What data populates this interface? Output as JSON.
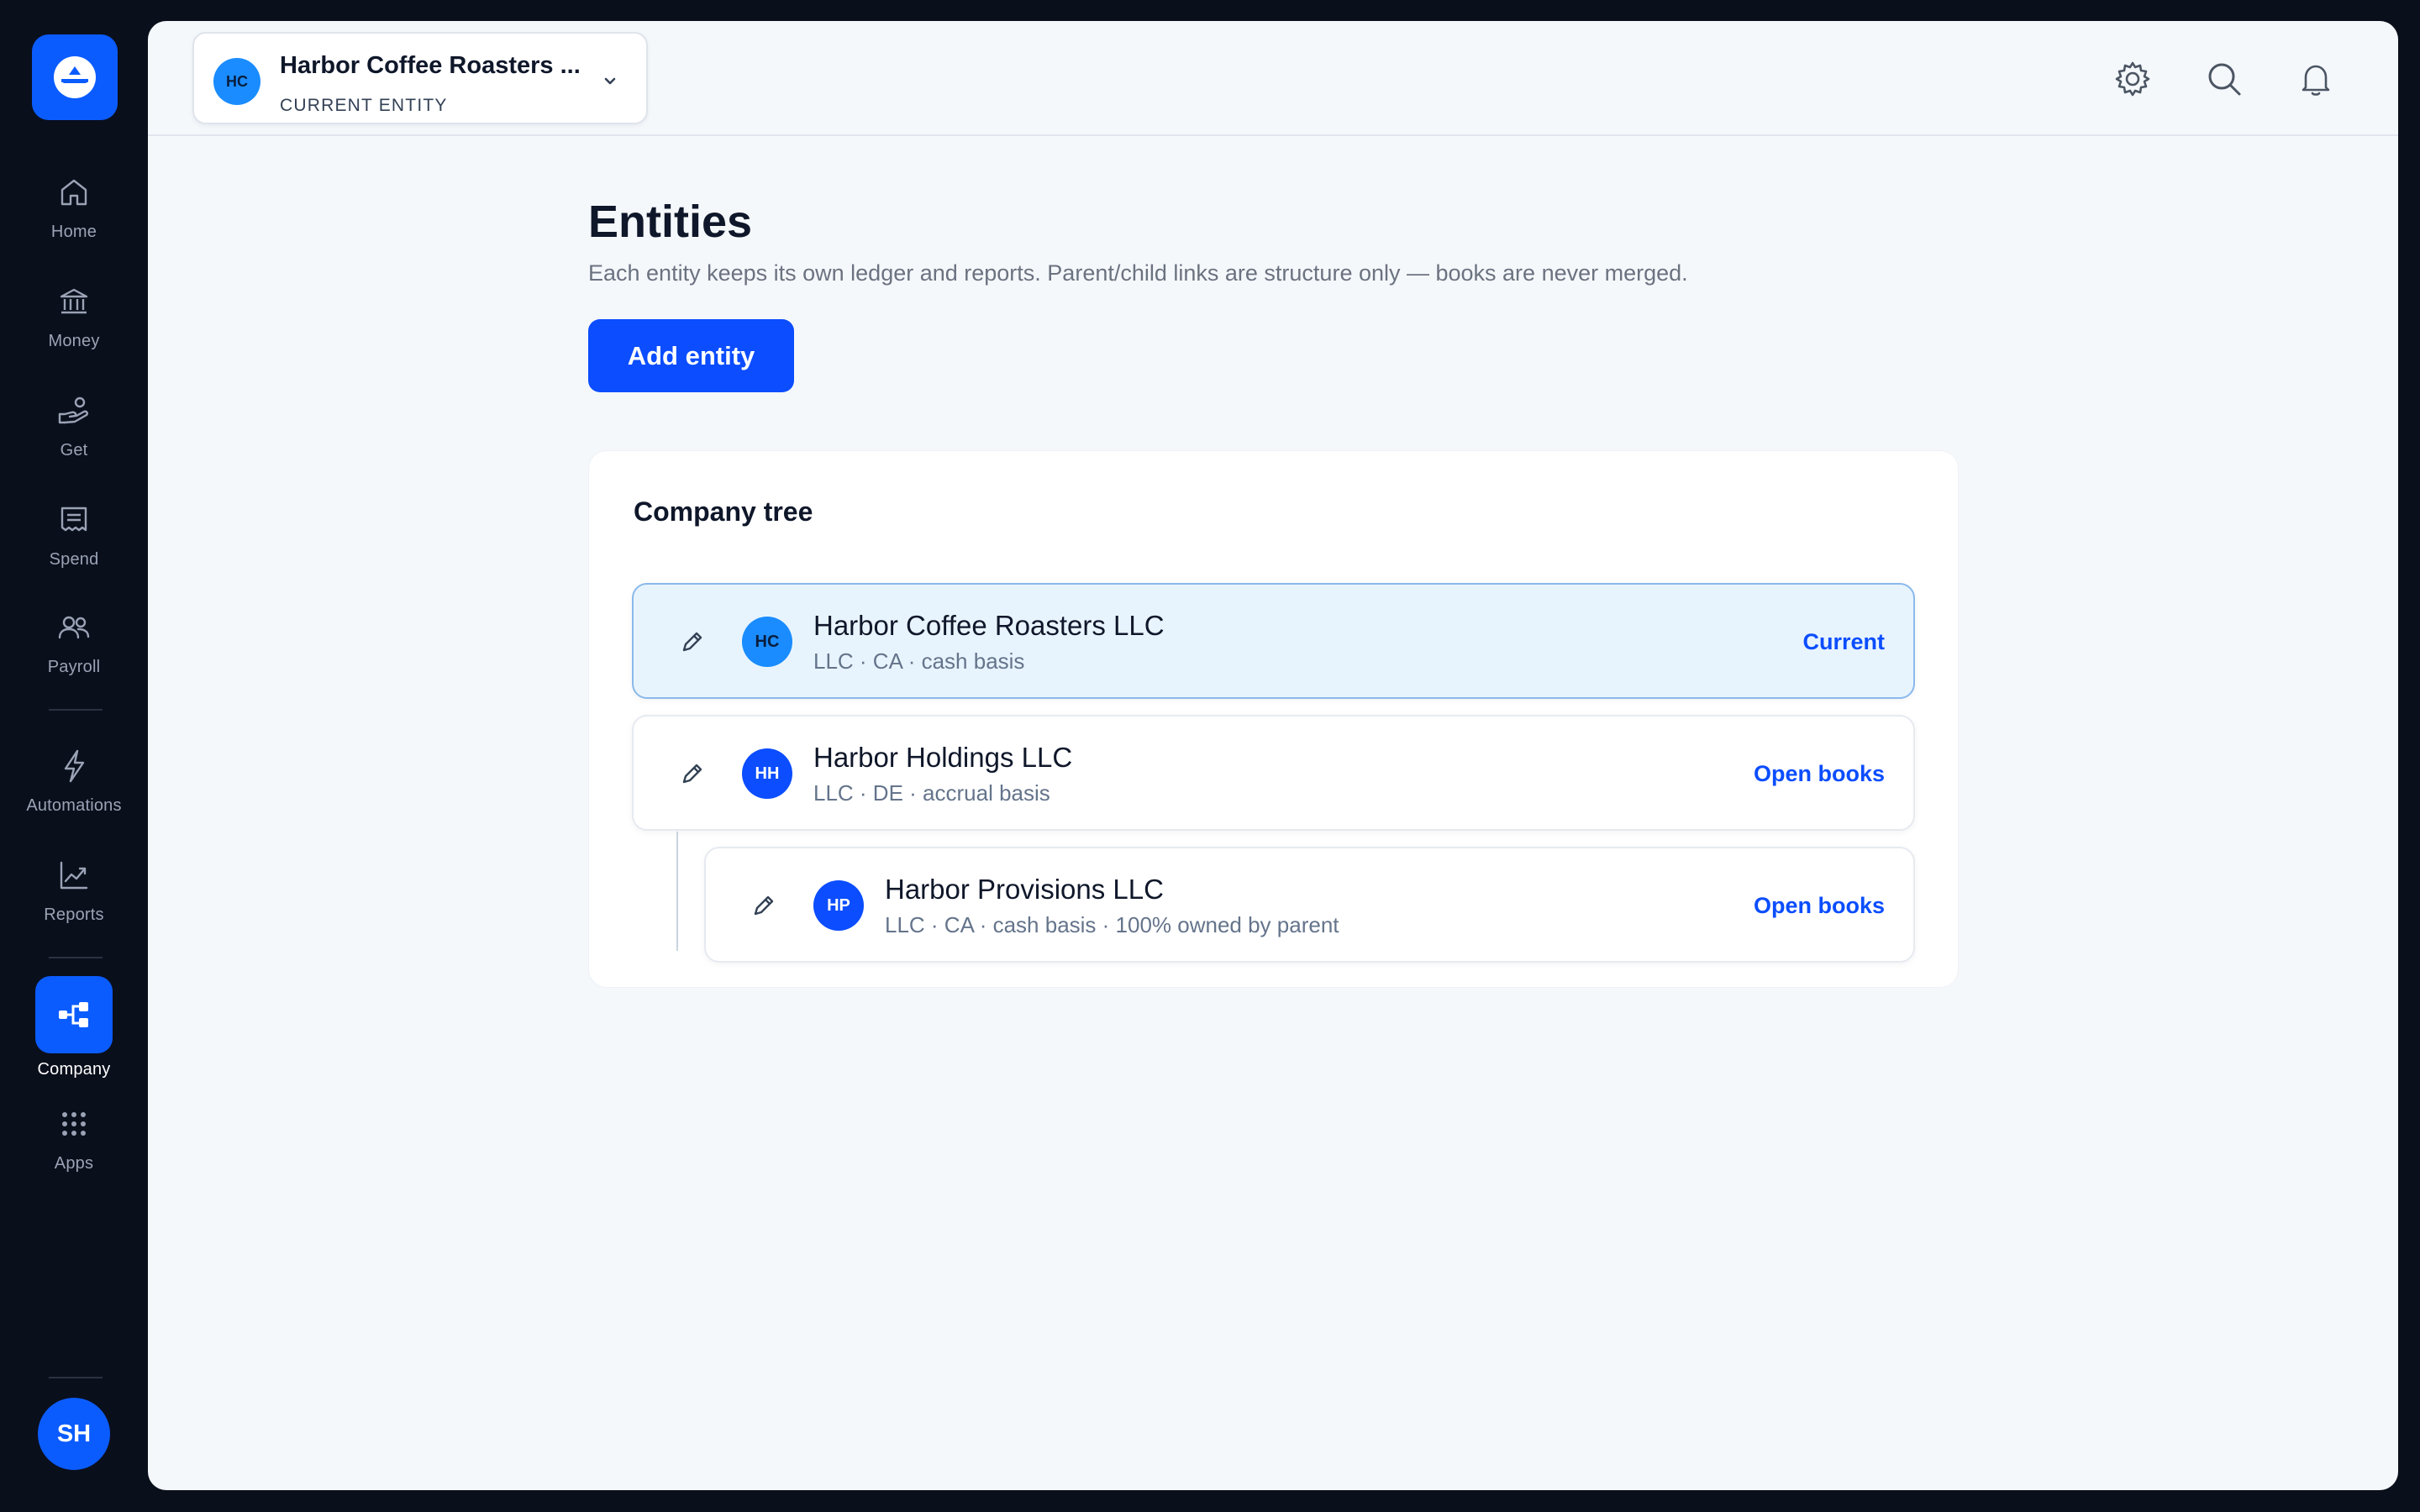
{
  "sidebar": {
    "items": [
      {
        "label": "Home",
        "icon": "home-icon"
      },
      {
        "label": "Money",
        "icon": "bank-icon"
      },
      {
        "label": "Get",
        "icon": "hand-coin-icon"
      },
      {
        "label": "Spend",
        "icon": "receipt-icon"
      },
      {
        "label": "Payroll",
        "icon": "people-icon"
      },
      {
        "label": "Automations",
        "icon": "lightning-icon"
      },
      {
        "label": "Reports",
        "icon": "trend-chart-icon"
      },
      {
        "label": "Company",
        "icon": "org-tree-icon",
        "active": true
      },
      {
        "label": "Apps",
        "icon": "grid-dots-icon"
      }
    ],
    "user_initials": "SH"
  },
  "switcher": {
    "initials": "HC",
    "name": "Harbor Coffee Roasters ...",
    "label": "CURRENT ENTITY"
  },
  "page": {
    "title": "Entities",
    "subtitle": "Each entity keeps its own ledger and reports. Parent/child links are structure only — books are never merged.",
    "add_button": "Add entity"
  },
  "tree": {
    "title": "Company tree",
    "entities": [
      {
        "initials": "HC",
        "name": "Harbor Coffee Roasters LLC",
        "meta": "LLC · CA · cash basis",
        "action": "Current",
        "current": true
      },
      {
        "initials": "HH",
        "name": "Harbor Holdings LLC",
        "meta": "LLC · DE · accrual basis",
        "action": "Open books"
      },
      {
        "initials": "HP",
        "name": "Harbor Provisions LLC",
        "meta": "LLC · CA · cash basis · 100% owned by parent",
        "action": "Open books",
        "child": true
      }
    ]
  },
  "colors": {
    "accent": "#0b4dff",
    "sidebar_bg": "#0a0f1c",
    "current_row_bg": "#e8f4fd",
    "current_avatar": "#1a8cff"
  }
}
